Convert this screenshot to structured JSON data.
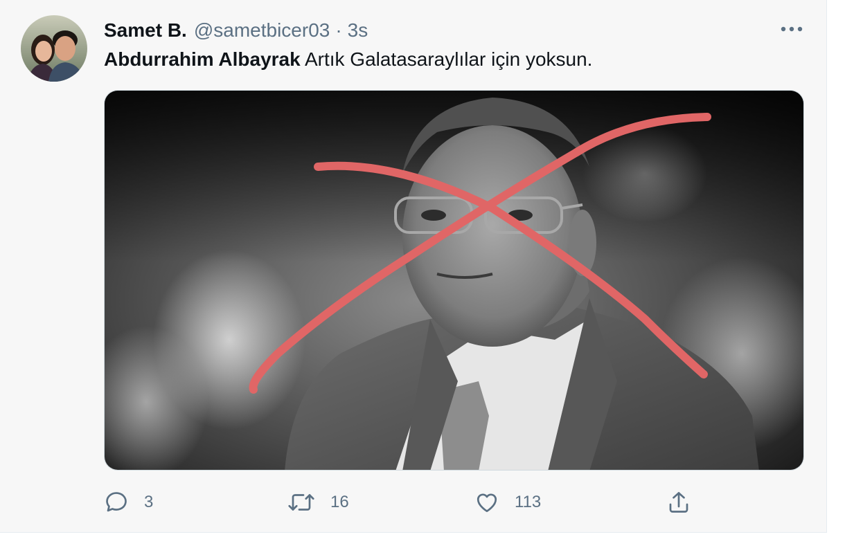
{
  "tweet": {
    "display_name": "Samet B.",
    "handle": "@sametbicer03",
    "separator": "·",
    "time": "3s",
    "mention": "Abdurrahim Albayrak",
    "text": " Artık Galatasaraylılar için yoksun.",
    "more_icon": "more-horizontal-icon",
    "media_description_icon": "photo"
  },
  "actions": {
    "reply": {
      "icon": "reply-icon",
      "count": "3"
    },
    "retweet": {
      "icon": "retweet-icon",
      "count": "16"
    },
    "like": {
      "icon": "heart-icon",
      "count": "113"
    },
    "share": {
      "icon": "share-icon"
    }
  },
  "colors": {
    "text_primary": "#0f1419",
    "text_secondary": "#5b7083",
    "background": "#f7f7f7",
    "cross_mark": "#e06666"
  }
}
